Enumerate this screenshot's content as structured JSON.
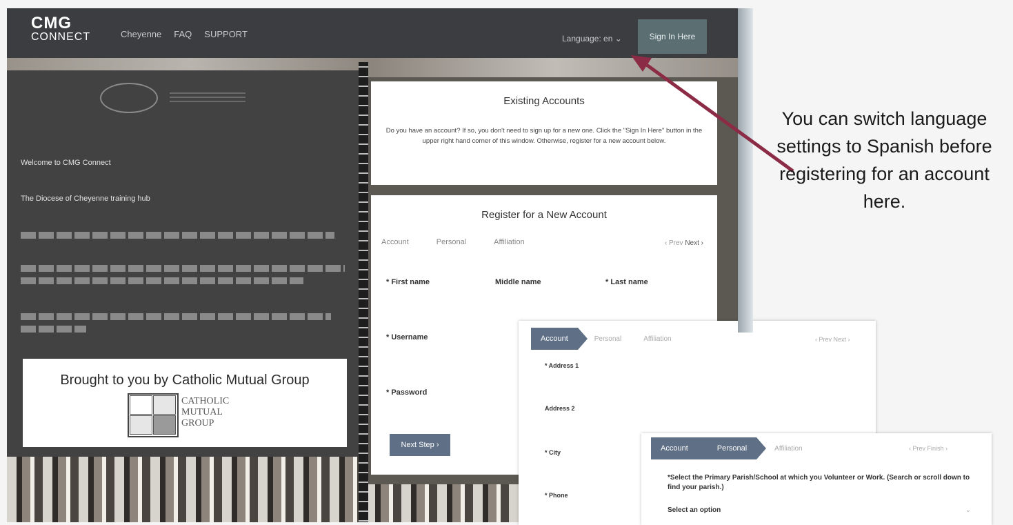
{
  "header": {
    "logo_line1": "CMG",
    "logo_line2": "CONNECT",
    "nav": [
      "Cheyenne",
      "FAQ",
      "SUPPORT"
    ],
    "language": "Language: en",
    "sign_in": "Sign In Here"
  },
  "left_panel": {
    "items": [
      "Welcome to CMG Connect",
      "The Diocese of Cheyenne training hub"
    ],
    "brought_by": "Brought to you by Catholic Mutual Group",
    "logo_words": [
      "CATHOLIC",
      "MUTUAL",
      "GROUP"
    ]
  },
  "existing_accounts": {
    "title": "Existing Accounts",
    "body": "Do you have an account? If so, you don't need to sign up for a new one. Click the \"Sign In Here\" button in the upper right hand corner of this window. Otherwise, register for a new account below."
  },
  "register": {
    "title": "Register for a New Account",
    "tabs": [
      "Account",
      "Personal",
      "Affiliation"
    ],
    "prev": "‹ Prev",
    "next": "Next ›",
    "labels": {
      "first_name": "* First name",
      "middle_name": "Middle name",
      "last_name": "* Last name",
      "username": "* Username",
      "password": "* Password"
    },
    "next_step": "Next Step ›"
  },
  "overlay1": {
    "steps": [
      "Account",
      "Personal",
      "Affiliation"
    ],
    "pager": "‹ Prev  Next ›",
    "fields": [
      "* Address 1",
      "Address 2",
      "* City",
      "* Phone"
    ]
  },
  "overlay2": {
    "steps": [
      "Account",
      "Personal",
      "Affiliation"
    ],
    "pager": "‹ Prev  Finish ›",
    "question": "*Select the Primary Parish/School at which you Volunteer or Work. (Search or scroll down to find your parish.)",
    "select_value": "Select an option"
  },
  "callout": {
    "text": "You can switch language settings to Spanish before registering for an account here."
  }
}
